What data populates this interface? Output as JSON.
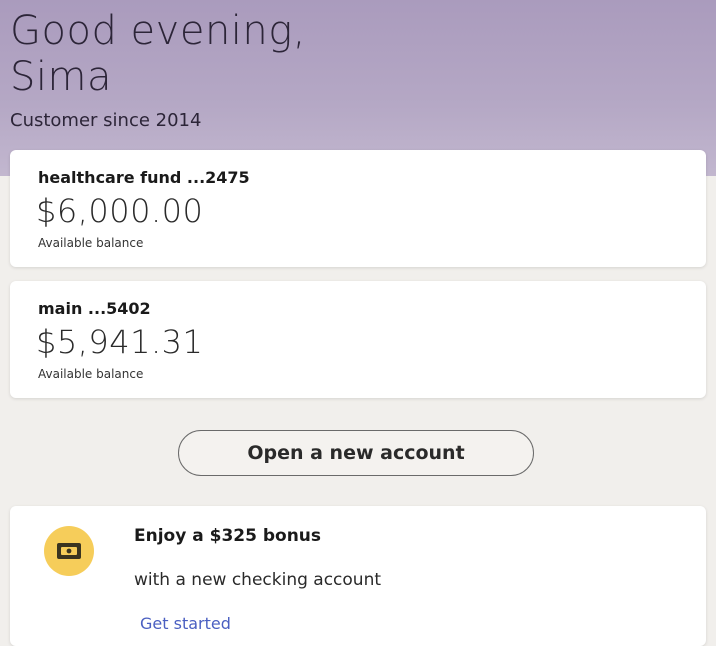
{
  "header": {
    "greeting": "Good evening,",
    "name": "Sima",
    "customer_since": "Customer since 2014"
  },
  "accounts": [
    {
      "name": "healthcare fund ...2475",
      "balance": "$6,000.00",
      "balance_label": "Available balance"
    },
    {
      "name": "main ...5402",
      "balance": "$5,941.31",
      "balance_label": "Available balance"
    }
  ],
  "actions": {
    "open_account_label": "Open a new account"
  },
  "promo": {
    "icon": "cash-icon",
    "title": "Enjoy a $325 bonus",
    "subtitle": "with a new checking account",
    "link": "Get started"
  },
  "colors": {
    "header_bg": "#b5a8c5",
    "page_bg": "#f1efec",
    "promo_icon_bg": "#f6cd5a",
    "link": "#4a5fc1"
  }
}
